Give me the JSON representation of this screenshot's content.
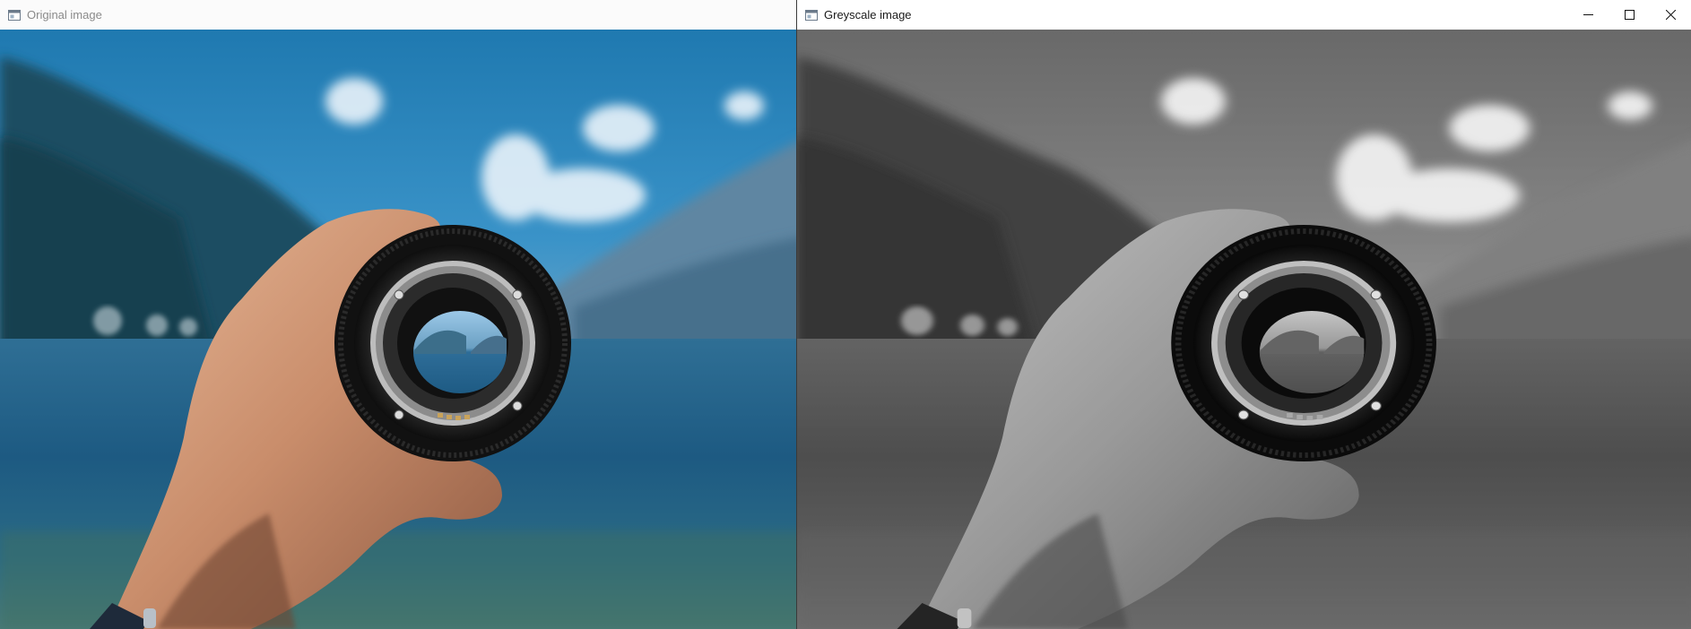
{
  "left_window": {
    "title": "Original image",
    "icon": "app-window-icon"
  },
  "right_window": {
    "title": "Greyscale image",
    "icon": "app-window-icon",
    "controls": {
      "minimize": "minimize-icon",
      "maximize": "maximize-icon",
      "close": "close-icon"
    }
  },
  "photo": {
    "subject": "hand holding camera lens over mountain lake"
  }
}
